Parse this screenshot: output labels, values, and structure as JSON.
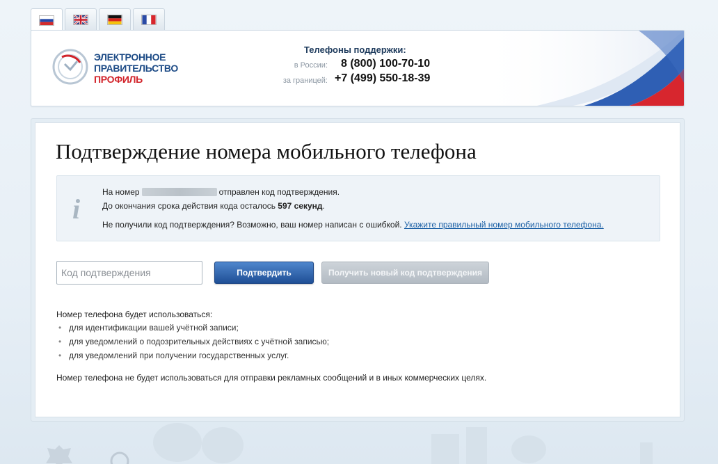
{
  "languages": [
    {
      "code": "ru",
      "name": "Русский",
      "active": true
    },
    {
      "code": "en",
      "name": "English",
      "active": false
    },
    {
      "code": "de",
      "name": "Deutsch",
      "active": false
    },
    {
      "code": "fr",
      "name": "Français",
      "active": false
    }
  ],
  "header": {
    "brand_line1": "ЭЛЕКТРОННОЕ",
    "brand_line2": "ПРАВИТЕЛЬСТВО",
    "brand_line3": "ПРОФИЛЬ",
    "support_title": "Телефоны поддержки:",
    "phone_russia_label": "в России:",
    "phone_russia": "8 (800) 100-70-10",
    "phone_abroad_label": "за границей:",
    "phone_abroad": "+7 (499) 550-18-39"
  },
  "main": {
    "title": "Подтверждение номера мобильного телефона",
    "info": {
      "line1_prefix": "На номер",
      "line1_suffix": "отправлен код подтверждения.",
      "line2_prefix": "До окончания срока действия кода осталось",
      "line2_seconds": "597 секунд",
      "line2_suffix": ".",
      "line3_text": "Не получили код подтверждения? Возможно, ваш номер написан с ошибкой.",
      "line3_link": "Укажите правильный номер мобильного телефона."
    },
    "code_placeholder": "Код подтверждения",
    "code_value": "",
    "confirm_button": "Подтвердить",
    "resend_button": "Получить новый код подтверждения",
    "usage_title": "Номер телефона будет использоваться:",
    "usage_items": [
      "для идентификации вашей учётной записи;",
      "для уведомлений о подозрительных действиях с учётной записью;",
      "для уведомлений при получении государственных услуг."
    ],
    "usage_note": "Номер телефона не будет использоваться для отправки рекламных сообщений и в иных коммерческих целях."
  },
  "colors": {
    "brand_blue": "#1d4b86",
    "brand_red": "#d2232a",
    "button_blue": "#2a5ba3",
    "link": "#1a5fa5"
  }
}
